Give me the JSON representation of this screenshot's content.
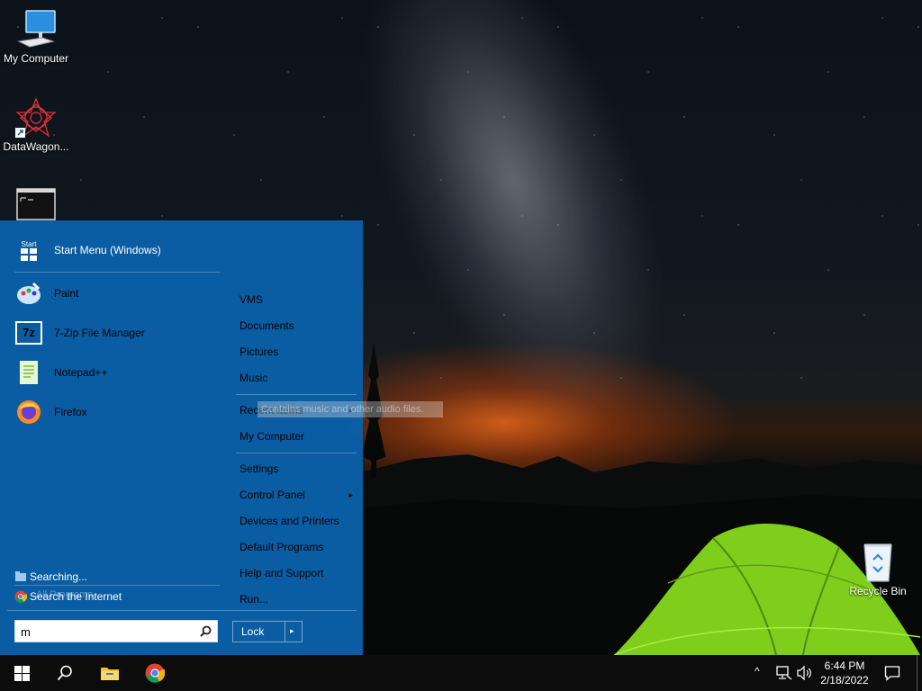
{
  "desktop": {
    "icons": [
      {
        "label": "My Computer"
      },
      {
        "label": "DataWagon..."
      },
      {
        "label": ""
      },
      {
        "label": "Recycle Bin"
      }
    ]
  },
  "start_menu": {
    "pinned": [
      {
        "label": "Start Menu (Windows)",
        "icon": "start-menu-icon"
      },
      {
        "label": "Paint",
        "icon": "paint-icon"
      },
      {
        "label": "7-Zip File Manager",
        "icon": "7zip-icon"
      },
      {
        "label": "Notepad++",
        "icon": "notepad-plus-plus-icon"
      },
      {
        "label": "Firefox",
        "icon": "firefox-icon"
      }
    ],
    "start_icon_text": "Start",
    "seven_zip_icon_text": "7z",
    "right": [
      {
        "label": "VMS"
      },
      {
        "label": "Documents"
      },
      {
        "label": "Pictures"
      },
      {
        "label": "Music"
      },
      {
        "label": "Recent Items"
      },
      {
        "label": "My Computer"
      },
      {
        "label": "Settings"
      },
      {
        "label": "Control Panel"
      },
      {
        "label": "Devices and Printers"
      },
      {
        "label": "Default Programs"
      },
      {
        "label": "Help and Support"
      },
      {
        "label": "Run..."
      }
    ],
    "tooltip": "Contains music and other audio files.",
    "searching_label": "Searching...",
    "search_internet_label": "Search the Internet",
    "all_programs_label": "All Programs",
    "search_value": "m",
    "lock_label": "Lock",
    "arrow_glyph": "▸"
  },
  "taskbar": {
    "time": "6:44 PM",
    "date": "2/18/2022",
    "tray_up_glyph": "^"
  },
  "colors": {
    "start_menu_bg": "#0a5fa6",
    "taskbar_bg": "#0c0c0c",
    "tent_green": "#8fdc22"
  }
}
